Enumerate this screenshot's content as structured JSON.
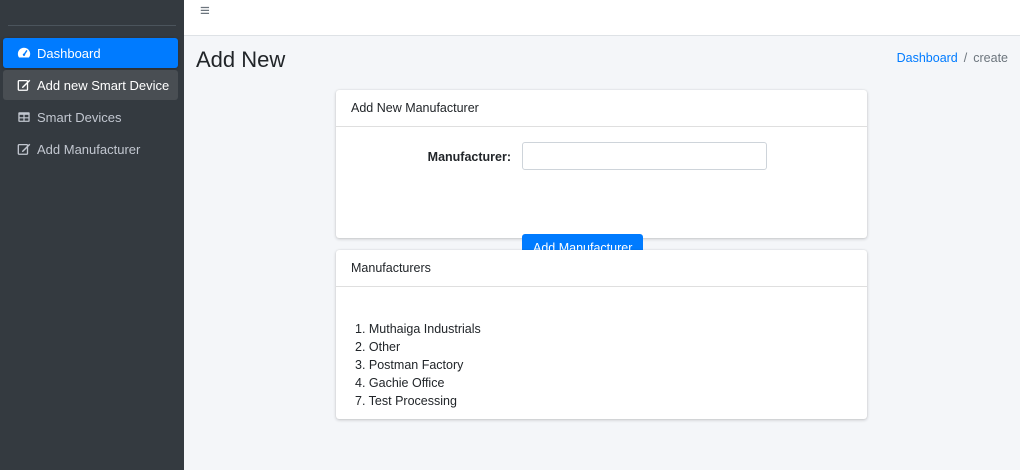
{
  "sidebar": {
    "items": [
      {
        "label": "Dashboard",
        "icon": "tachometer-icon",
        "state": "active"
      },
      {
        "label": "Add new Smart Device",
        "icon": "edit-icon",
        "state": "hover"
      },
      {
        "label": "Smart Devices",
        "icon": "table-icon",
        "state": ""
      },
      {
        "label": "Add Manufacturer",
        "icon": "edit-icon",
        "state": ""
      }
    ]
  },
  "topbar": {
    "menu_icon": "hamburger-icon"
  },
  "header": {
    "title": "Add New",
    "breadcrumb": {
      "link": "Dashboard",
      "separator": "/",
      "current": "create"
    }
  },
  "form_card": {
    "title": "Add New Manufacturer",
    "label": "Manufacturer:",
    "input_value": "",
    "button": "Add Manufacturer"
  },
  "list_card": {
    "title": "Manufacturers",
    "items": [
      "1. Muthaiga Industrials",
      "2. Other",
      "3. Postman Factory",
      "4. Gachie Office",
      "7. Test Processing"
    ]
  },
  "colors": {
    "primary": "#007bff",
    "sidebar": "#343a40",
    "background": "#f4f6f9"
  }
}
